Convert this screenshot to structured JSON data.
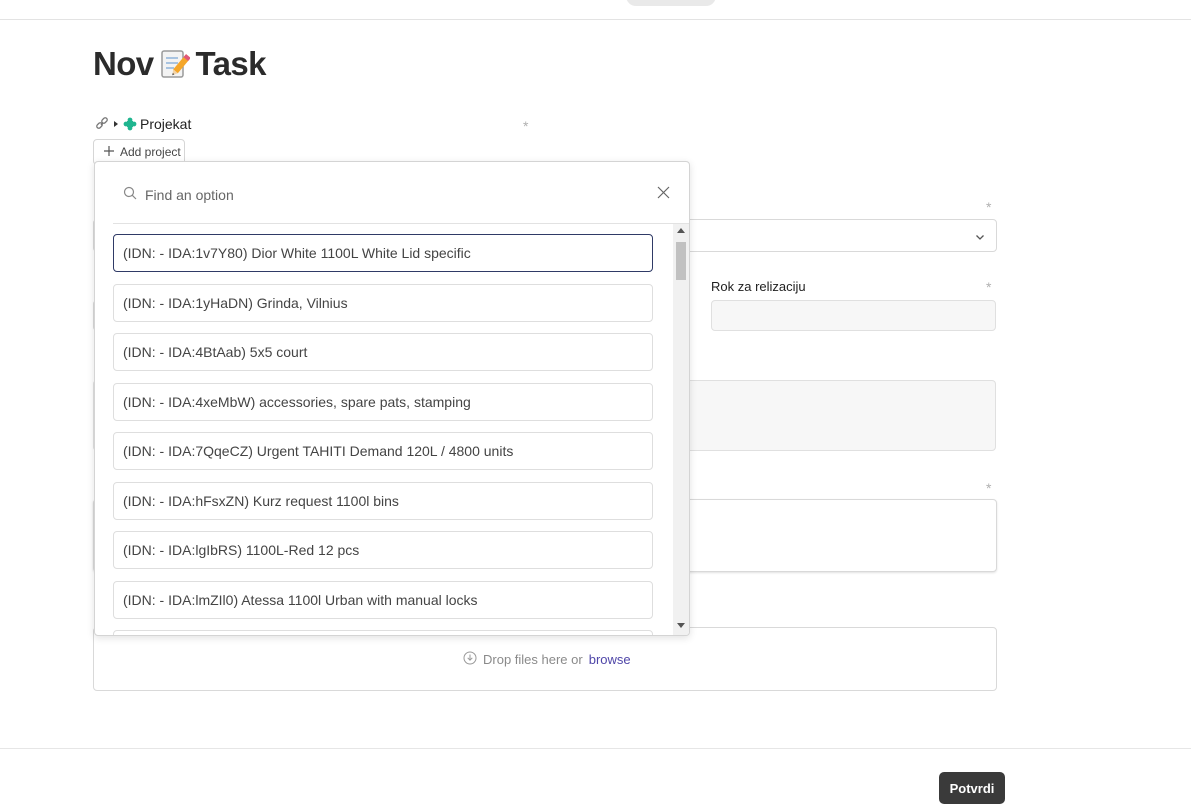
{
  "page": {
    "title_part1": "Nov",
    "title_icon": "memo-icon",
    "title_part2": "Task"
  },
  "project_field": {
    "label": "Projekat",
    "required_mark": "*",
    "add_button_label": "Add project"
  },
  "deadline_field": {
    "label": "Rok za relizaciju",
    "required_mark": "*"
  },
  "other_required_marks": [
    "*",
    "*"
  ],
  "dropzone": {
    "text": "Drop files here or",
    "link": "browse"
  },
  "footer": {
    "confirm_label": "Potvrdi"
  },
  "dropdown": {
    "search_placeholder": "Find an option",
    "options": [
      "(IDN: - IDA:1v7Y80) Dior White 1100L White Lid specific",
      "(IDN: - IDA:1yHaDN) Grinda, Vilnius",
      "(IDN: - IDA:4BtAab) 5x5 court",
      "(IDN: - IDA:4xeMbW) accessories, spare pats, stamping",
      "(IDN: - IDA:7QqeCZ) Urgent TAHITI Demand 120L / 4800 units",
      "(IDN: - IDA:hFsxZN) Kurz request 1100l bins",
      "(IDN: - IDA:lgIbRS) 1100L-Red 12 pcs",
      "(IDN: - IDA:lmZIl0) Atessa 1100l Urban with manual locks",
      ""
    ],
    "selected_index": 0
  },
  "colors": {
    "accent": "#2f3a66",
    "link": "#4f46a8",
    "button_bg": "#3a3a3a",
    "project_icon": "#1fb58f"
  }
}
